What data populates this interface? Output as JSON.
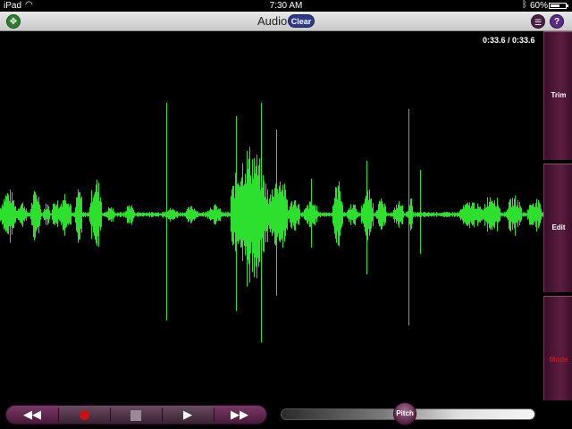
{
  "status_bar": {
    "carrier": "iPad",
    "time": "7:30 AM",
    "battery": "60%",
    "battery_level": 0.6
  },
  "nav_bar": {
    "title": "Audio",
    "clear_label": "Clear"
  },
  "time_readout": "0:33.6 / 0:33.6",
  "side_panel": {
    "trim": "Trim",
    "edit": "Edit",
    "mode": "Mode"
  },
  "pitch": {
    "label": "Pitch",
    "level": 0.47
  },
  "colors": {
    "waveform": "#2ee02e",
    "panel": "#4a1a3d",
    "accent": "#2d3a8c",
    "mode": "#c81818"
  },
  "icons": {
    "move": "move-arrows-icon",
    "list": "list-icon",
    "help": "help-icon"
  }
}
